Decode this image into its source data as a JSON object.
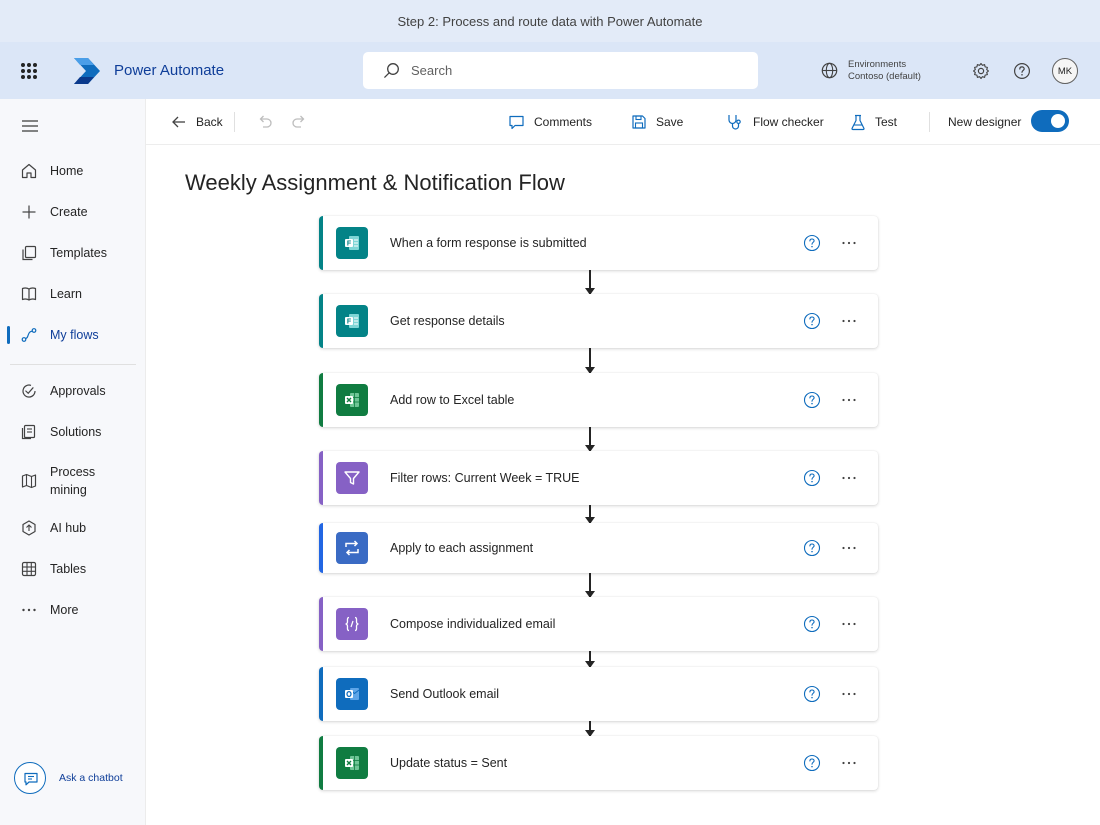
{
  "caption": "Step 2: Process and route data with Power Automate",
  "app": {
    "name": "Power Automate",
    "search_placeholder": "Search",
    "environment_label": "Environments",
    "environment_value": "Contoso (default)",
    "avatar_initials": "MK",
    "brand_color": "#0f6cbd"
  },
  "sidebar": {
    "items": [
      {
        "label": "Home",
        "icon": "home-icon"
      },
      {
        "label": "Create",
        "icon": "plus-icon"
      },
      {
        "label": "Templates",
        "icon": "templates-icon"
      },
      {
        "label": "Learn",
        "icon": "book-icon"
      },
      {
        "label": "My flows",
        "icon": "flow-icon",
        "active": true
      },
      {
        "label": "Approvals",
        "icon": "approvals-icon"
      },
      {
        "label": "Solutions",
        "icon": "solutions-icon"
      },
      {
        "label": "Process mining",
        "icon": "process-mining-icon"
      },
      {
        "label": "AI hub",
        "icon": "ai-hub-icon"
      },
      {
        "label": "Tables",
        "icon": "table-icon"
      },
      {
        "label": "More",
        "icon": "more-icon"
      }
    ],
    "chatbot_label": "Ask a chatbot"
  },
  "toolbar": {
    "back": "Back",
    "comments": "Comments",
    "save": "Save",
    "flow_checker": "Flow checker",
    "test": "Test",
    "new_designer": "New designer",
    "new_designer_on": true
  },
  "flow": {
    "title": "Weekly Assignment & Notification Flow",
    "steps": [
      {
        "label": "When a form response is submitted",
        "icon": "forms-icon",
        "accent": "#038387"
      },
      {
        "label": "Get response details",
        "icon": "forms-icon",
        "accent": "#038387"
      },
      {
        "label": "Add row to Excel table",
        "icon": "excel-icon",
        "accent": "#107c41"
      },
      {
        "label": "Filter rows: Current Week = TRUE",
        "icon": "filter-icon",
        "accent": "#8661c5"
      },
      {
        "label": "Apply to each assignment",
        "icon": "loop-icon",
        "accent": "#2266e3"
      },
      {
        "label": "Compose individualized email",
        "icon": "compose-icon",
        "accent": "#8661c5"
      },
      {
        "label": "Send Outlook email",
        "icon": "outlook-icon",
        "accent": "#0f6cbd"
      },
      {
        "label": "Update status = Sent",
        "icon": "excel-icon",
        "accent": "#107c41"
      }
    ]
  }
}
